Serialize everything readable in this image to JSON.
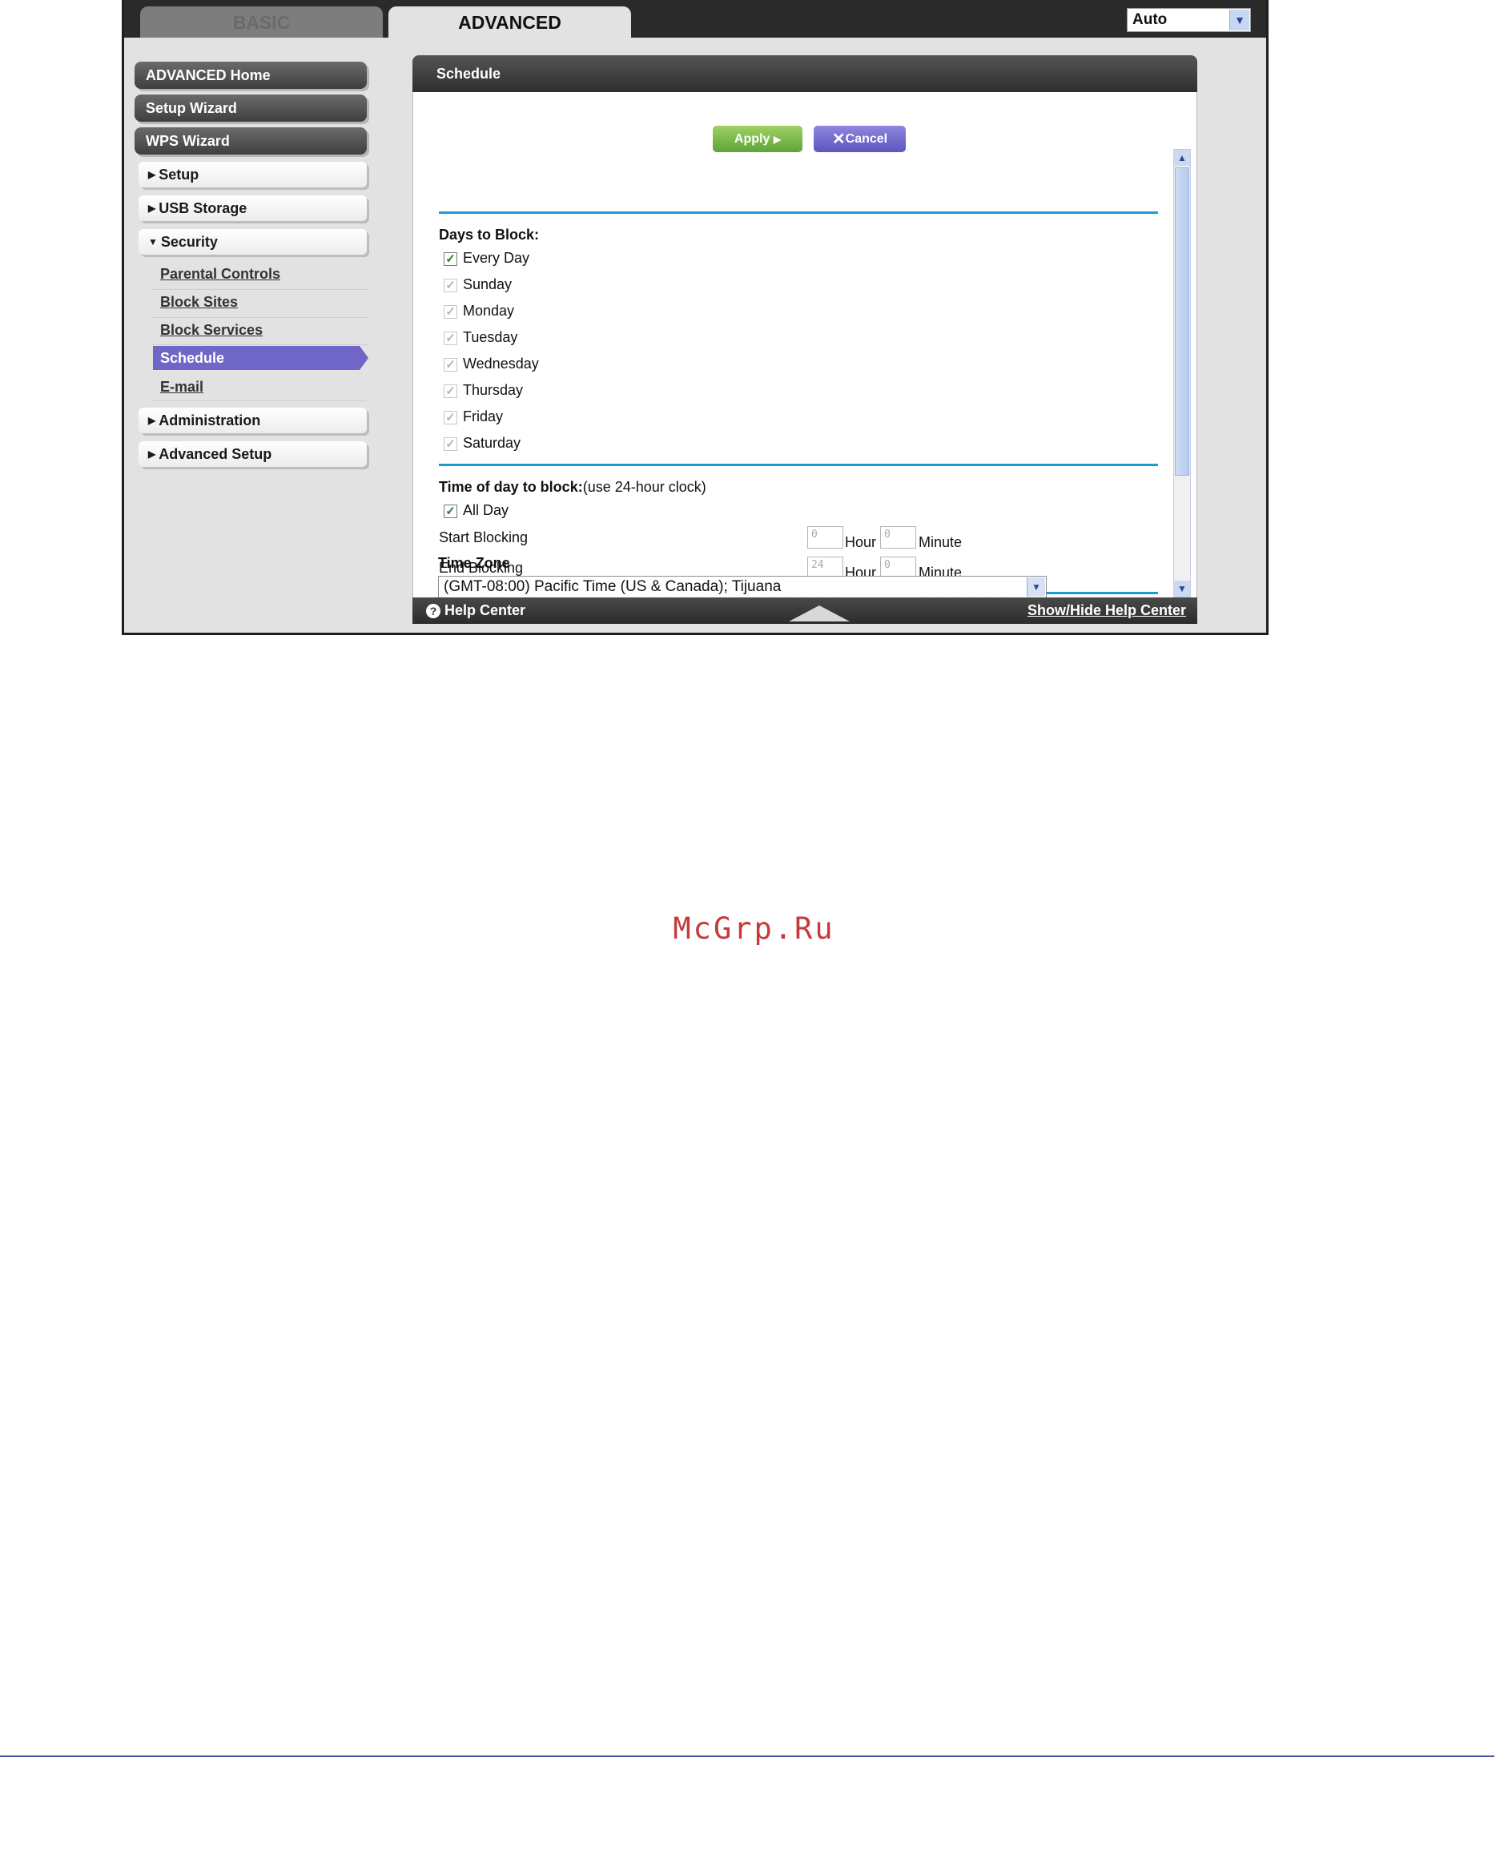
{
  "tabs": {
    "basic": "BASIC",
    "advanced": "ADVANCED"
  },
  "language": {
    "selected": "Auto"
  },
  "sidebar": {
    "advanced_home": "ADVANCED Home",
    "setup_wizard": "Setup Wizard",
    "wps_wizard": "WPS Wizard",
    "setup": "Setup",
    "usb_storage": "USB Storage",
    "security": "Security",
    "security_items": [
      "Parental Controls",
      "Block Sites",
      "Block Services",
      "Schedule",
      "E-mail"
    ],
    "administration": "Administration",
    "advanced_setup": "Advanced Setup"
  },
  "panel": {
    "title": "Schedule",
    "apply": "Apply",
    "cancel": "Cancel",
    "days_title": "Days to Block:",
    "every_day": "Every Day",
    "days": [
      "Sunday",
      "Monday",
      "Tuesday",
      "Wednesday",
      "Thursday",
      "Friday",
      "Saturday"
    ],
    "time_title": "Time of day to block:",
    "time_note": "(use 24-hour clock)",
    "all_day": "All Day",
    "start_blocking": "Start Blocking",
    "end_blocking": "End Blocking",
    "start_hour": "0",
    "start_minute": "0",
    "end_hour": "24",
    "end_minute": "0",
    "hour_label": "Hour",
    "minute_label": "Minute",
    "timezone_title": "Time Zone",
    "timezone_value": "(GMT-08:00) Pacific Time (US & Canada); Tijuana"
  },
  "footer": {
    "help_center": "Help Center",
    "show_hide": "Show/Hide Help Center"
  },
  "watermark": "McGrp.Ru",
  "colors": {
    "accent_blue": "#1c9bd7",
    "selected_purple": "#6f66c8",
    "apply_green": "#6db043",
    "cancel_purple": "#6e66cc"
  },
  "icons": [
    "triangle-right-icon",
    "triangle-down-icon",
    "check-icon",
    "question-icon",
    "close-icon",
    "chevron-down-icon"
  ]
}
